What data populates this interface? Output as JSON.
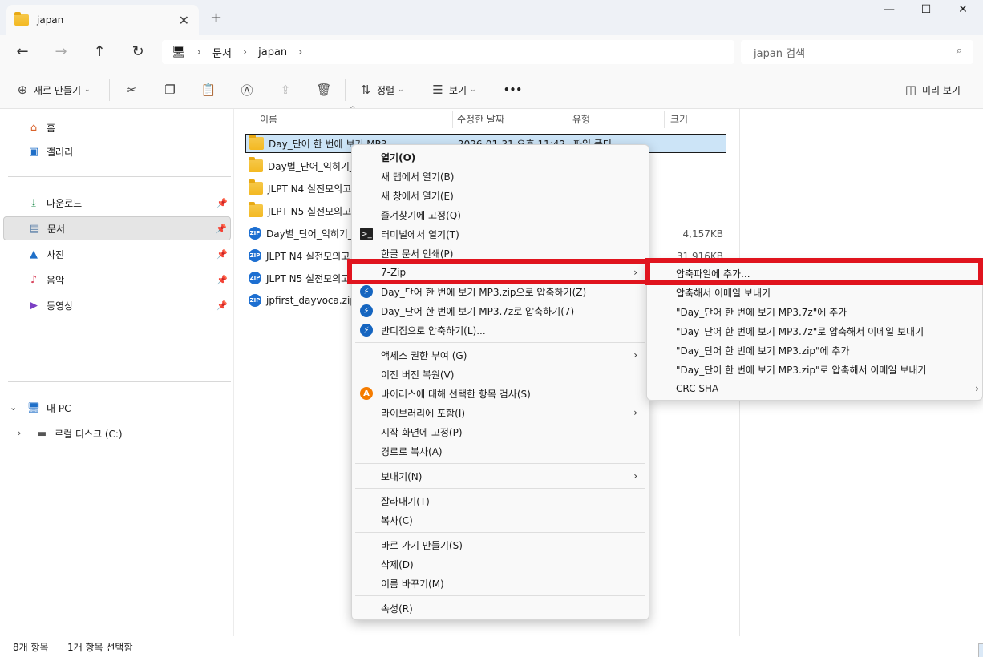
{
  "window": {
    "tab_title": "japan",
    "close_tab": "✕",
    "new_tab": "+",
    "min": "—",
    "max": "☐",
    "close": "✕"
  },
  "nav": {
    "back": "←",
    "forward": "→",
    "up": "↑",
    "refresh": "↻",
    "breadcrumb": [
      "문서",
      "japan"
    ],
    "search_placeholder": "japan 검색"
  },
  "toolbar": {
    "new": "새로 만들기",
    "sort": "정렬",
    "view": "보기",
    "more": "•••",
    "preview": "미리 보기"
  },
  "sidebar": {
    "home": "홈",
    "gallery": "갤러리",
    "downloads": "다운로드",
    "documents": "문서",
    "pictures": "사진",
    "music": "음악",
    "videos": "동영상",
    "this_pc": "내 PC",
    "local_disk": "로컬 디스크 (C:)"
  },
  "columns": {
    "name": "이름",
    "modified": "수정한 날짜",
    "type": "유형",
    "size": "크기"
  },
  "files": [
    {
      "name": "Day_단어 한 번에 보기 MP3",
      "date": "2026-01-31 오후 11:42",
      "type": "파일 폴더",
      "size": ""
    },
    {
      "name": "Day별_단어_익히기_",
      "size": ""
    },
    {
      "name": "JLPT N4 실전모의고",
      "size": ""
    },
    {
      "name": "JLPT N5 실전모의고",
      "size": ""
    },
    {
      "name": "Day별_단어_익히기_",
      "size": "4,157KB"
    },
    {
      "name": "JLPT N4 실전모의고",
      "size": "31,916KB"
    },
    {
      "name": "JLPT N5 실전모의고",
      "size": ""
    },
    {
      "name": "jpfirst_dayvoca.zip",
      "size": ""
    }
  ],
  "context_menu": {
    "open": "열기(O)",
    "open_new_tab": "새 탭에서 열기(B)",
    "open_new_window": "새 창에서 열기(E)",
    "pin_favorites": "즐겨찾기에 고정(Q)",
    "open_terminal": "터미널에서 열기(T)",
    "hangul_print": "한글 문서 인쇄(P)",
    "sevenzip": "7-Zip",
    "zip_compress": "Day_단어 한 번에 보기 MP3.zip으로 압축하기(Z)",
    "sevenz_compress": "Day_단어 한 번에 보기 MP3.7z로 압축하기(7)",
    "bandizip": "반디집으로 압축하기(L)...",
    "access": "액세스 권한 부여 (G)",
    "restore": "이전 버전 복원(V)",
    "virus_scan": "바이러스에 대해 선택한 항목 검사(S)",
    "library": "라이브러리에 포함(I)",
    "pin_start": "시작 화면에 고정(P)",
    "copy_path": "경로로 복사(A)",
    "send_to": "보내기(N)",
    "cut": "잘라내기(T)",
    "copy": "복사(C)",
    "shortcut": "바로 가기 만들기(S)",
    "delete": "삭제(D)",
    "rename": "이름 바꾸기(M)",
    "properties": "속성(R)"
  },
  "submenu": {
    "add_archive": "압축파일에 추가...",
    "compress_email": "압축해서 이메일 보내기",
    "add_7z": "\"Day_단어 한 번에 보기 MP3.7z\"에 추가",
    "7z_email": "\"Day_단어 한 번에 보기 MP3.7z\"로 압축해서 이메일 보내기",
    "add_zip": "\"Day_단어 한 번에 보기 MP3.zip\"에 추가",
    "zip_email": "\"Day_단어 한 번에 보기 MP3.zip\"로 압축해서 이메일 보내기",
    "crc": "CRC SHA"
  },
  "status": {
    "count": "8개 항목",
    "selected": "1개 항목 선택함"
  },
  "colors": {
    "highlight_red": "#e0141e",
    "selection_blue": "#cce4f7"
  }
}
